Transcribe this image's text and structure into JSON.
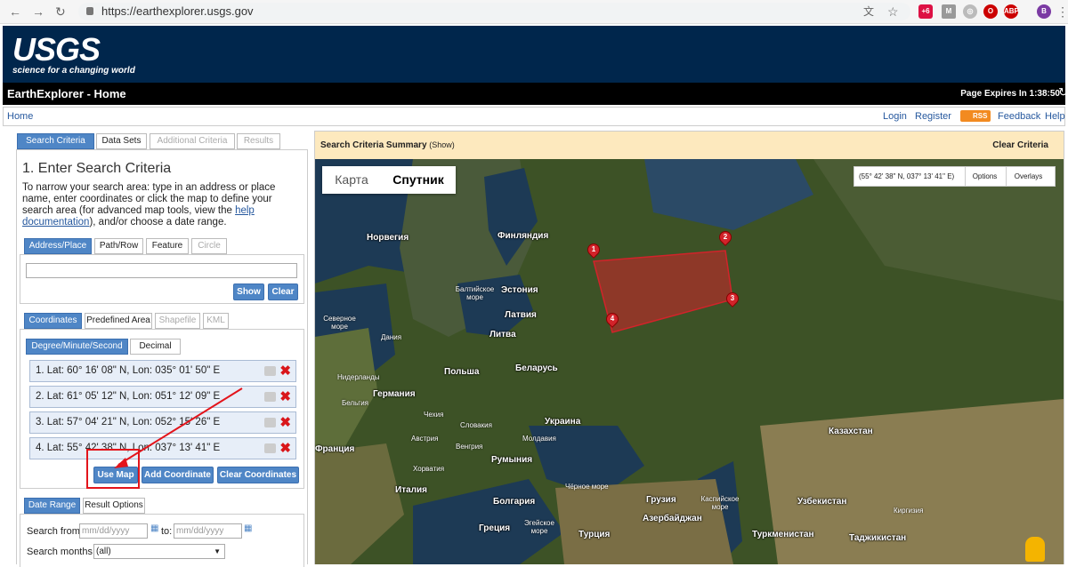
{
  "browser": {
    "url": "https://earthexplorer.usgs.gov",
    "ext_badge": "+6",
    "profile": "B",
    "abp": "ABP"
  },
  "banner": {
    "logo": "USGS",
    "tagline": "science for a changing world"
  },
  "titlebar": {
    "title": "EarthExplorer - Home",
    "expires": "Page Expires In 1:38:50"
  },
  "nav": {
    "home": "Home",
    "login": "Login",
    "register": "Register",
    "rss": "RSS",
    "feedback": "Feedback",
    "help": "Help"
  },
  "main_tabs": [
    "Search Criteria",
    "Data Sets",
    "Additional Criteria",
    "Results"
  ],
  "left": {
    "heading": "1. Enter Search Criteria",
    "intro_a": "To narrow your search area: type in an address or place name, enter coordinates or click the map to define your search area (for advanced map tools, view the ",
    "intro_link": "help documentation",
    "intro_b": "), and/or choose a date range.",
    "loc_tabs": [
      "Address/Place",
      "Path/Row",
      "Feature",
      "Circle"
    ],
    "address_value": "",
    "show_btn": "Show",
    "clear_btn": "Clear",
    "coord_tabs": [
      "Coordinates",
      "Predefined Area",
      "Shapefile",
      "KML"
    ],
    "fmt_tabs": [
      "Degree/Minute/Second",
      "Decimal"
    ],
    "coordinates": [
      "1.  Lat: 60° 16' 08\" N, Lon: 035° 01' 50\" E",
      "2.  Lat: 61° 05' 12\" N, Lon: 051° 12' 09\" E",
      "3.  Lat: 57° 04' 21\" N, Lon: 052° 15' 26\" E",
      "4.  Lat: 55° 42' 38\" N, Lon: 037° 13' 41\" E"
    ],
    "use_map_btn": "Use Map",
    "add_coord_btn": "Add Coordinate",
    "clear_coords_btn": "Clear Coordinates",
    "date_tabs": [
      "Date Range",
      "Result Options"
    ],
    "search_from_label": "Search from:",
    "date_placeholder": "mm/dd/yyyy",
    "to_label": "to:",
    "search_months_label": "Search months:",
    "months_value": "(all)"
  },
  "map": {
    "summary_title": "Search Criteria Summary",
    "summary_show": "(Show)",
    "clear_criteria": "Clear Criteria",
    "type_tabs": [
      "Карта",
      "Спутник"
    ],
    "coord_readout": "(55° 42' 38\" N, 037° 13' 41\" E)",
    "options": "Options",
    "overlays": "Overlays",
    "labels_major": [
      "Норвегия",
      "Финляндия",
      "Эстония",
      "Латвия",
      "Литва",
      "Польша",
      "Беларусь",
      "Германия",
      "Украина",
      "Франция",
      "Румыния",
      "Италия",
      "Болгария",
      "Греция",
      "Турция",
      "Грузия",
      "Азербайджан",
      "Казахстан",
      "Узбекистан",
      "Туркменистан",
      "Таджикистан",
      "Дания",
      "Нидерланды"
    ],
    "labels_minor": [
      "Балтийское море",
      "Северное море",
      "Бельгия",
      "Чехия",
      "Словакия",
      "Австрия",
      "Венгрия",
      "Молдавия",
      "Хорватия",
      "Чёрное море",
      "Каспийское море",
      "Киргизия",
      "Эгейское море"
    ],
    "pins": [
      "1",
      "2",
      "3",
      "4"
    ],
    "polygon_color": "#d2232a"
  }
}
